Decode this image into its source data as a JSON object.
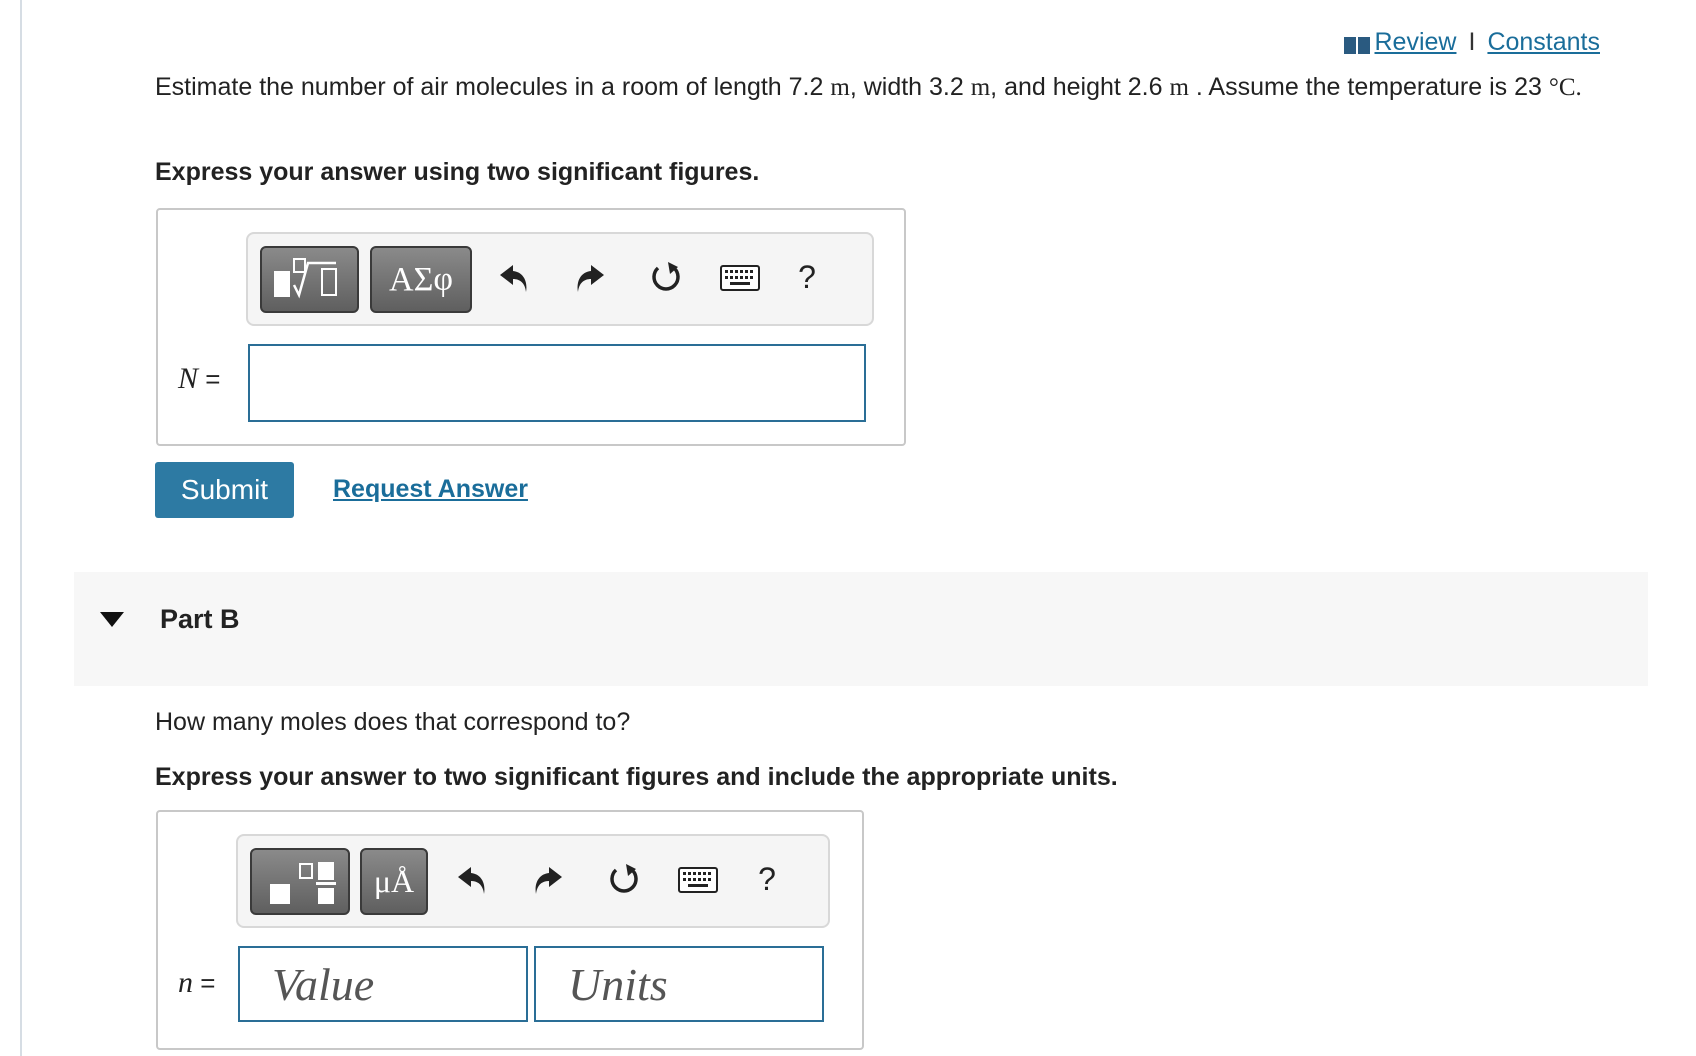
{
  "header": {
    "review_label": "Review",
    "separator": "I",
    "constants_label": "Constants"
  },
  "part_a": {
    "problem_prefix": "Estimate the number of air molecules in a room of length 7.2",
    "unit_m": "m",
    "width_text": ", width 3.2",
    "height_text": ", and height 2.6",
    "temp_text": ". Assume the temperature is 23",
    "temp_unit": "°C.",
    "instruction": "Express your answer using two significant figures.",
    "toolbar": {
      "greek_label": "ΑΣφ",
      "help_label": "?"
    },
    "variable_label": "N",
    "equals": "=",
    "answer_value": "",
    "submit_label": "Submit",
    "request_answer_label": "Request Answer"
  },
  "part_b": {
    "title": "Part B",
    "question": "How many moles does that correspond to?",
    "instruction": "Express your answer to two significant figures and include the appropriate units.",
    "toolbar": {
      "units_label": "μÅ",
      "help_label": "?"
    },
    "variable_label": "n",
    "equals": "=",
    "value_placeholder": "Value",
    "units_placeholder": "Units"
  },
  "colors": {
    "link": "#1a6d9a",
    "submit_bg": "#2d7aa3",
    "input_border": "#2a6e96",
    "part_band_bg": "#f7f7f7"
  },
  "icons": [
    "book-icon",
    "template-icon",
    "greek-letters-icon",
    "undo-icon",
    "redo-icon",
    "reset-icon",
    "keyboard-icon",
    "help-icon",
    "fraction-icon",
    "units-icon",
    "collapse-caret-icon"
  ]
}
